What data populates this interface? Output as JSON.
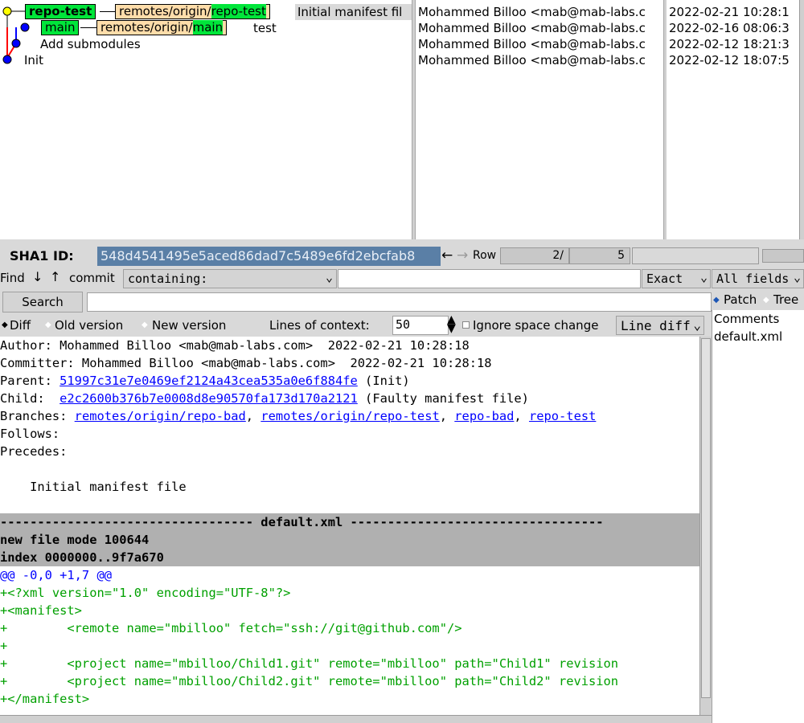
{
  "history": {
    "graph": [
      {
        "subject": "",
        "branch_label": "repo-test",
        "remote_prefix": "remotes/origin/",
        "remote_branch": "repo-test",
        "message_after": "Initial manifest fil"
      },
      {
        "subject": "test",
        "branch_label": "main",
        "remote_prefix": "remotes/origin/",
        "remote_branch": "main"
      },
      {
        "subject": "Add submodules"
      },
      {
        "subject": "Init"
      }
    ],
    "authors": [
      "Mohammed Billoo <mab@mab-labs.c",
      "Mohammed Billoo <mab@mab-labs.c",
      "Mohammed Billoo <mab@mab-labs.c",
      "Mohammed Billoo <mab@mab-labs.c"
    ],
    "dates": [
      "2022-02-21 10:28:1",
      "2022-02-16 08:06:3",
      "2022-02-12 18:21:3",
      "2022-02-12 18:07:5"
    ]
  },
  "sha": {
    "label": "SHA1 ID:",
    "value": "548d4541495e5aced86dad7c5489e6fd2ebcfab8",
    "back_icon": "←",
    "forward_icon": "→",
    "row_label": "Row",
    "row_current": "2/",
    "row_total": "5"
  },
  "find": {
    "label": "Find",
    "down_icon": "↓",
    "up_icon": "↑",
    "type_label": "commit",
    "mode_value": "containing:",
    "dropdown_icon": "⌄",
    "query": "",
    "match_value": "Exact",
    "fields_value": "All fields"
  },
  "search": {
    "button_label": "Search",
    "query": ""
  },
  "diff_options": {
    "diff_label": "Diff",
    "old_label": "Old version",
    "new_label": "New version",
    "context_label": "Lines of context:",
    "context_value": "50",
    "ignore_space_label": "Ignore space change",
    "mode_value": "Line diff"
  },
  "commit": {
    "author_line": "Author: Mohammed Billoo <mab@mab-labs.com>  2022-02-21 10:28:18",
    "committer_line": "Committer: Mohammed Billoo <mab@mab-labs.com>  2022-02-21 10:28:18",
    "parent_label": "Parent: ",
    "parent_sha": "51997c31e7e0469ef2124a43cea535a0e6f884fe",
    "parent_desc": " (Init)",
    "child_label": "Child:  ",
    "child_sha": "e2c2600b376b7e0008d8e90570fa173d170a2121",
    "child_desc": " (Faulty manifest file)",
    "branches_label": "Branches: ",
    "branches": [
      "remotes/origin/repo-bad",
      "remotes/origin/repo-test",
      "repo-bad",
      "repo-test"
    ],
    "branch_sep": ", ",
    "follows_label": "Follows:",
    "precedes_label": "Precedes:",
    "message": "    Initial manifest file"
  },
  "diff": {
    "file_header": "---------------------------------- default.xml ----------------------------------",
    "mode_line": "new file mode 100644",
    "index_line": "index 0000000..9f7a670",
    "hunk_line": "@@ -0,0 +1,7 @@",
    "added_lines": [
      "+<?xml version=\"1.0\" encoding=\"UTF-8\"?>",
      "+<manifest>",
      "+        <remote name=\"mbilloo\" fetch=\"ssh://git@github.com\"/>",
      "+",
      "+        <project name=\"mbilloo/Child1.git\" remote=\"mbilloo\" path=\"Child1\" revision",
      "+        <project name=\"mbilloo/Child2.git\" remote=\"mbilloo\" path=\"Child2\" revision",
      "+</manifest>"
    ]
  },
  "file_pane": {
    "patch_label": "Patch",
    "tree_label": "Tree",
    "files": [
      "Comments",
      "default.xml"
    ]
  },
  "colors": {
    "local_branch": "#00e63a",
    "remote_branch": "#ffddaa",
    "head_node": "#ffff00",
    "commit_node": "#0000ff",
    "graph_line_1": "#0000ff",
    "graph_line_2": "#ff0000",
    "added": "#00a000",
    "hunk": "#0000ff",
    "sha_bg": "#5a7fa6"
  }
}
